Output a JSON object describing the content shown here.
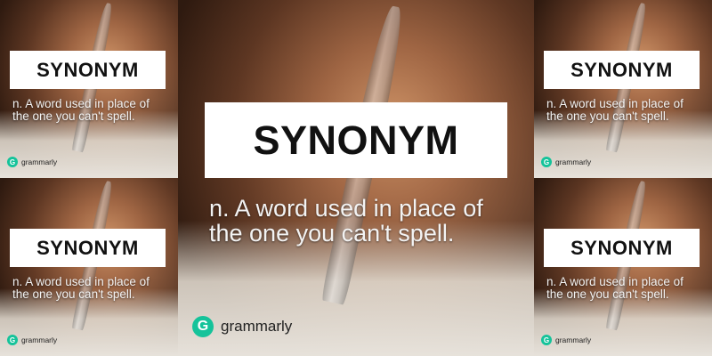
{
  "card": {
    "title": "SYNONYM",
    "definition_line1": "n. A word used in place of",
    "definition_line2": "the one you can't spell.",
    "brand_name": "grammarly",
    "brand_logo_glyph": "G",
    "colors": {
      "title_bg": "#ffffff",
      "title_text": "#111111",
      "definition_text": "#f3f3f3",
      "brand_accent": "#15c39a"
    }
  }
}
